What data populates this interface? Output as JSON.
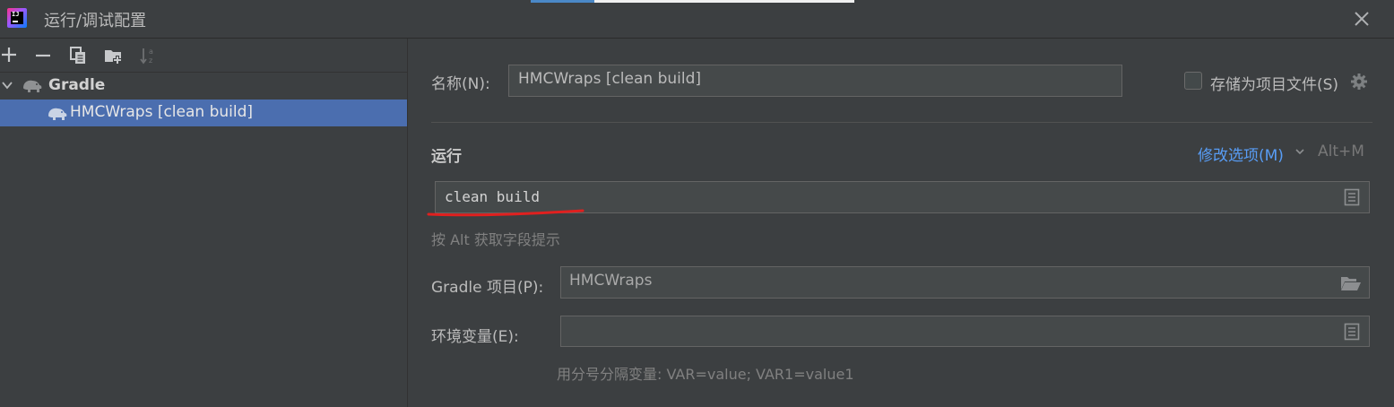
{
  "window": {
    "title": "运行/调试配置"
  },
  "toolbar": {
    "add_icon": "plus-icon",
    "remove_icon": "minus-icon",
    "copy_icon": "copy-icon",
    "new_folder_icon": "folder-add-icon",
    "sort_icon": "sort-alpha-icon"
  },
  "tree": {
    "group_label": "Gradle",
    "items": [
      {
        "label": "HMCWraps [clean build]"
      }
    ]
  },
  "form": {
    "name_label": "名称(N):",
    "name_value": "HMCWraps [clean build]",
    "store_as_project_label": "存储为项目文件(S)",
    "run_section_title": "运行",
    "modify_options_label": "修改选项(M)",
    "modify_options_shortcut": "Alt+M",
    "tasks_value": "clean build",
    "tasks_hint": "按 Alt 获取字段提示",
    "gradle_project_label": "Gradle 项目(P):",
    "gradle_project_value": "HMCWraps",
    "env_label": "环境变量(E):",
    "env_value": "",
    "env_hint": "用分号分隔变量: VAR=value; VAR1=value1"
  },
  "colors": {
    "background": "#3c3f41",
    "selection": "#4b6eaf",
    "link": "#589df6",
    "annotation": "#e0201f"
  }
}
